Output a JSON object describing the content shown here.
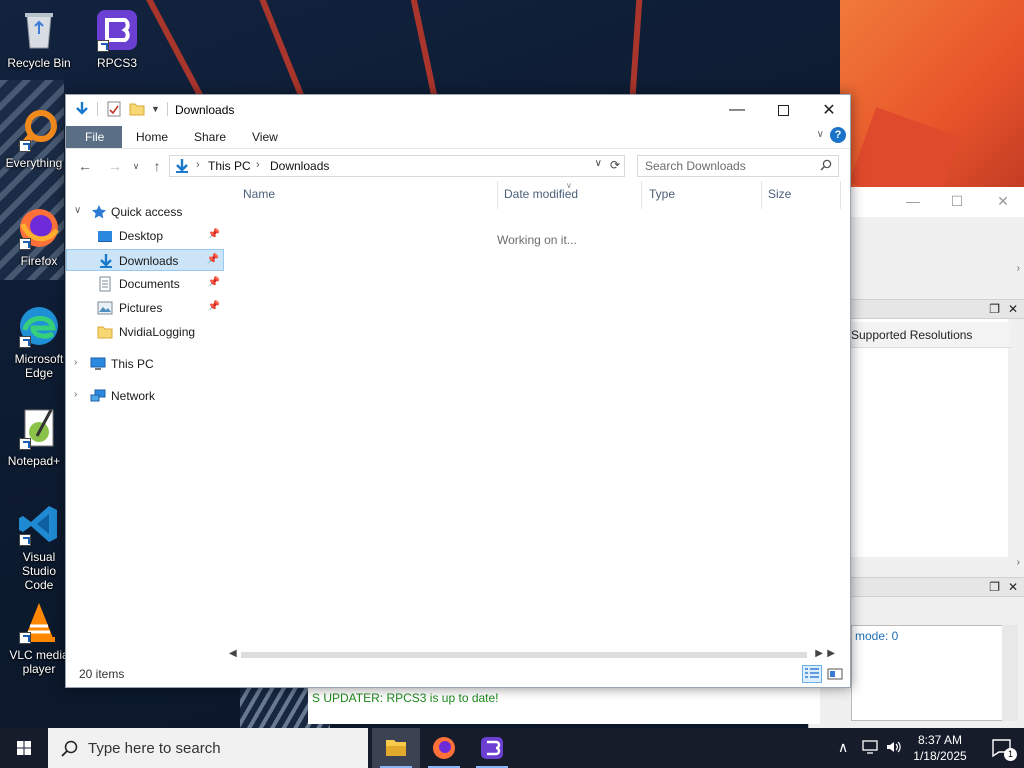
{
  "desktop": {
    "icons": [
      {
        "label": "Recycle Bin"
      },
      {
        "label": "RPCS3"
      },
      {
        "label": "Everything"
      },
      {
        "label": "Firefox"
      },
      {
        "label": "Microsoft Edge"
      },
      {
        "label": "Notepad+"
      },
      {
        "label": "Visual Studio Code"
      },
      {
        "label": "VLC media player"
      }
    ]
  },
  "background_window": {
    "column_header": "Supported Resolutions",
    "log_text": "mode: 0",
    "updater_text": "S UPDATER: RPCS3 is up to date!"
  },
  "explorer": {
    "title": "Downloads",
    "ribbon_tabs": [
      "File",
      "Home",
      "Share",
      "View"
    ],
    "help_label": "?",
    "address": {
      "crumbs": [
        "This PC",
        "Downloads"
      ]
    },
    "search": {
      "placeholder": "Search Downloads"
    },
    "sidebar": {
      "quick_access": "Quick access",
      "items": [
        {
          "label": "Desktop",
          "pinned": true
        },
        {
          "label": "Downloads",
          "pinned": true,
          "selected": true
        },
        {
          "label": "Documents",
          "pinned": true
        },
        {
          "label": "Pictures",
          "pinned": true
        },
        {
          "label": "NvidiaLogging",
          "pinned": false
        }
      ],
      "this_pc": "This PC",
      "network": "Network"
    },
    "columns": [
      "Name",
      "Date modified",
      "Type",
      "Size"
    ],
    "status_message": "Working on it...",
    "item_count": "20 items"
  },
  "taskbar": {
    "search_placeholder": "Type here to search",
    "time": "8:37 AM",
    "date": "1/18/2025",
    "notification_count": "1"
  },
  "colors": {
    "accent": "#1979ca",
    "selected_bg": "#cce4f7",
    "taskbar": "#161c2a"
  }
}
